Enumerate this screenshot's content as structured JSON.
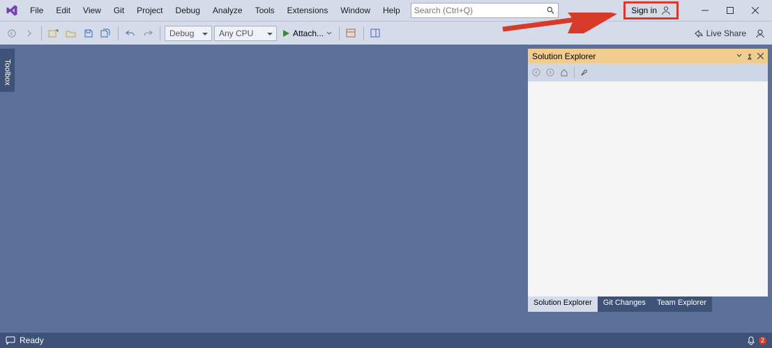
{
  "menubar": {
    "items": [
      "File",
      "Edit",
      "View",
      "Git",
      "Project",
      "Debug",
      "Analyze",
      "Tools",
      "Extensions",
      "Window",
      "Help"
    ],
    "search_placeholder": "Search (Ctrl+Q)",
    "sign_in": "Sign in"
  },
  "toolbar": {
    "config": "Debug",
    "platform": "Any CPU",
    "attach_label": "Attach...",
    "live_share": "Live Share"
  },
  "sidebar": {
    "toolbox": "Toolbox"
  },
  "solution_explorer": {
    "title": "Solution Explorer",
    "tabs": [
      "Solution Explorer",
      "Git Changes",
      "Team Explorer"
    ]
  },
  "statusbar": {
    "ready": "Ready",
    "notifications": "2"
  }
}
